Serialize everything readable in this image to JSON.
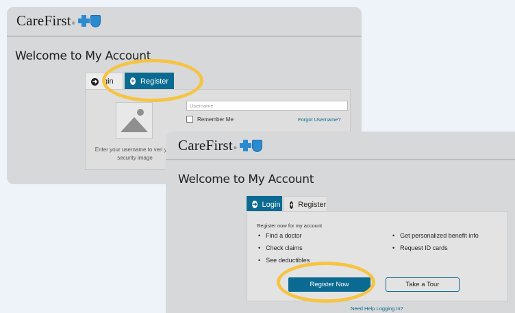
{
  "brand": {
    "name": "CareFirst",
    "tm": "®"
  },
  "back_card": {
    "page_title": "Welcome to My Account",
    "tabs": {
      "login_label": "gin",
      "register_label": "Register"
    },
    "login": {
      "username_placeholder": "Username",
      "remember_label": "Remember Me",
      "forgot_link": "Forgot Username?",
      "hint": "Enter your username to veri your security image"
    }
  },
  "front_card": {
    "page_title": "Welcome to My Account",
    "tabs": {
      "login_label": "Login",
      "register_label": "Register"
    },
    "register": {
      "intro": "Register now for my account",
      "benefits_left": [
        "Find a doctor",
        "Check claims",
        "See deductibles"
      ],
      "benefits_right": [
        "Get personalized benefit info",
        "Request ID cards"
      ],
      "register_now_label": "Register Now",
      "take_tour_label": "Take a Tour"
    },
    "help_link": "Need Help Logging In?"
  },
  "icons": {
    "arrow": "arrow-right-circle-icon",
    "plus": "plus-circle-icon",
    "image": "image-placeholder-icon"
  },
  "colors": {
    "primary": "#0b6a91",
    "highlight": "#f6c443",
    "card_bg": "#d7d8d9",
    "page_bg": "#eef3fa"
  }
}
